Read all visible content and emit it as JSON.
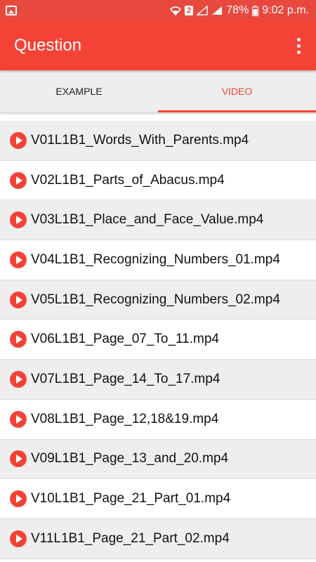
{
  "status": {
    "sim": "2",
    "battery": "78%",
    "time": "9:02 p.m."
  },
  "appbar": {
    "title": "Question",
    "menu_icon": "overflow-menu-icon"
  },
  "tabs": [
    {
      "label": "EXAMPLE",
      "active": false
    },
    {
      "label": "VIDEO",
      "active": true
    }
  ],
  "videos": [
    "V01L1B1_Words_With_Parents.mp4",
    "V02L1B1_Parts_of_Abacus.mp4",
    "V03L1B1_Place_and_Face_Value.mp4",
    "V04L1B1_Recognizing_Numbers_01.mp4",
    "V05L1B1_Recognizing_Numbers_02.mp4",
    "V06L1B1_Page_07_To_11.mp4",
    "V07L1B1_Page_14_To_17.mp4",
    "V08L1B1_Page_12,18&19.mp4",
    "V09L1B1_Page_13_and_20.mp4",
    "V10L1B1_Page_21_Part_01.mp4",
    "V11L1B1_Page_21_Part_02.mp4"
  ],
  "colors": {
    "accent": "#f44336",
    "statusbar": "#e8483d"
  }
}
